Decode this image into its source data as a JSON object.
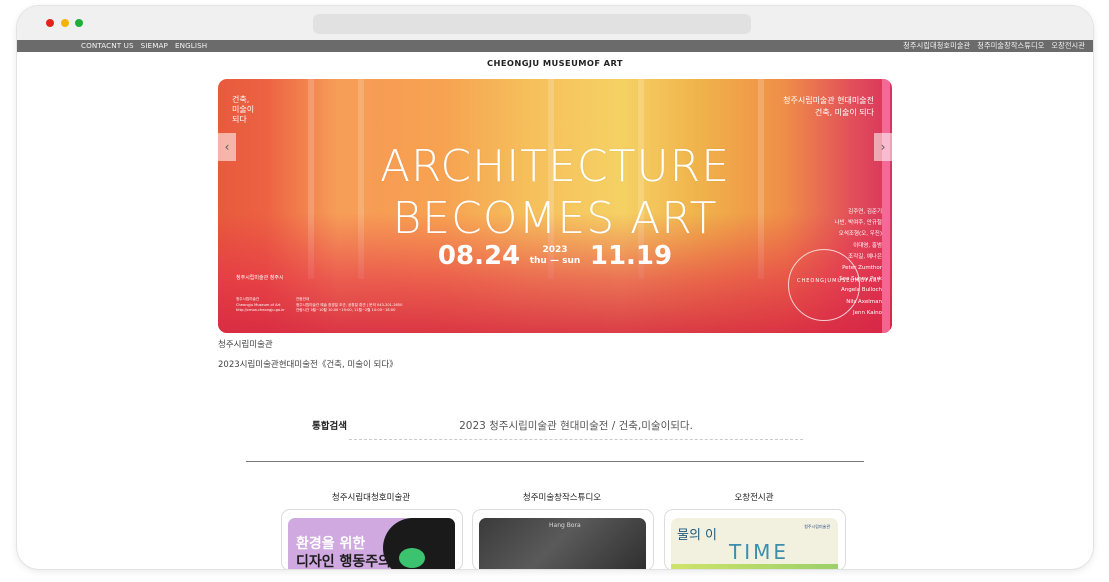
{
  "topbar": {
    "left_links": [
      "CONTACNT US",
      "SIEMAP",
      "ENGLISH"
    ],
    "right_links": [
      "청주시립대청호미술관",
      "청주미술창작스튜디오",
      "오창전시관"
    ]
  },
  "site": {
    "title": "CHEONGJU MUSEUMOF ART"
  },
  "hero": {
    "headline_line1": "ARCHITECTURE",
    "headline_line2": "BECOMES ART",
    "date_start": "08.24",
    "year": "2023",
    "days": "thu — sun",
    "date_end": "11.19",
    "logo_text_top": "건축,",
    "logo_text_mid": "미술이",
    "logo_text_bot": "되다",
    "title_ko_line1": "청주시립미술관 현대미술전",
    "title_ko_line2": "건축, 미술이 되다",
    "artists": [
      "김주연, 김준기",
      "나빈, 박여주, 안규철",
      "오석조형(오, 우진)",
      "이대영, 홍범",
      "조각길, 예나은",
      "Peter Zumthor",
      "Soo Sunny Park",
      "Angela Bulloch",
      "Nils Axelman",
      "Jenn Kaino"
    ],
    "stamp_text": "CHEONGJUMUSEUMOFART",
    "bl_logo": "청주시립미술관  청주시",
    "bl_info_lines": [
      "청주시립미술관",
      "Cheongju Museum of Art",
      "http://cmoa.cheongju.go.kr"
    ],
    "bm_info_lines": [
      "관람안내",
      "청주시립미술관 예술 창경일 조관, 공휴일 휴관 | 문의 043-201-2650",
      "관람시간 3월~10월 10:00~19:00, 11월~2월 10:00~18:00"
    ]
  },
  "nav": {
    "prev_icon": "‹",
    "next_icon": "›"
  },
  "captions": {
    "line1": "청주시립미술관",
    "line2": "2023시립미술관현대미술전《건축, 미술이 되다》"
  },
  "search": {
    "label": "통합검색",
    "value": "2023 청주시립미술관 현대미술전 / 건축,미술이되다."
  },
  "cards": [
    {
      "title": "청주시립대청호미술관",
      "thumb_line1": "환경을 위한",
      "thumb_line2": "디자인 행동주의"
    },
    {
      "title": "청주미술창작스튜디오",
      "thumb_text": "Hang Bora"
    },
    {
      "title": "오창전시관",
      "thumb_text": "물의 이",
      "thumb_time": "TIME",
      "thumb_logo": "청주시립미술관"
    }
  ]
}
